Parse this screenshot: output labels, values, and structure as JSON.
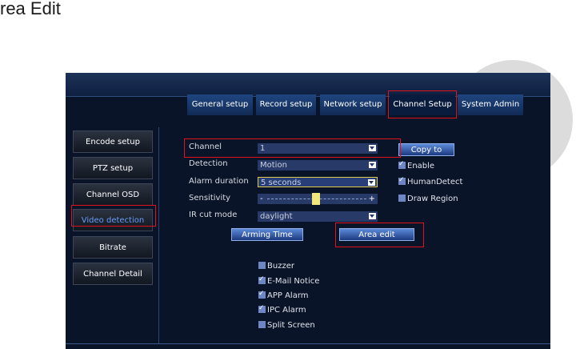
{
  "page_title": "rea Edit",
  "tabs": [
    {
      "label": "General setup"
    },
    {
      "label": "Record setup"
    },
    {
      "label": "Network setup"
    },
    {
      "label": "Channel Setup"
    },
    {
      "label": "System Admin"
    }
  ],
  "active_tab": "Channel Setup",
  "sidebar": {
    "items": [
      {
        "label": "Encode setup"
      },
      {
        "label": "PTZ setup"
      },
      {
        "label": "Channel OSD"
      },
      {
        "label": "Video detection"
      },
      {
        "label": "Bitrate"
      },
      {
        "label": "Channel Detail"
      }
    ],
    "active": "Video detection"
  },
  "form": {
    "channel": {
      "label": "Channel",
      "value": "1"
    },
    "detection": {
      "label": "Detection",
      "value": "Motion"
    },
    "alarm_duration": {
      "label": "Alarm duration",
      "value": "5 seconds"
    },
    "sensitivity": {
      "label": "Sensitivity",
      "level": 0.5
    },
    "ir_cut_mode": {
      "label": "IR cut mode",
      "value": "daylight"
    }
  },
  "buttons": {
    "copy_to": "Copy to",
    "arming_time": "Arming Time",
    "area_edit": "Area edit"
  },
  "right_options": [
    {
      "label": "Enable",
      "checked": true
    },
    {
      "label": "HumanDetect",
      "checked": true
    },
    {
      "label": "Draw Region",
      "checked": false
    }
  ],
  "alarm_options": [
    {
      "label": "Buzzer",
      "checked": false
    },
    {
      "label": "E-Mail Notice",
      "checked": true
    },
    {
      "label": "APP Alarm",
      "checked": true
    },
    {
      "label": "IPC Alarm",
      "checked": true
    },
    {
      "label": "Split Screen",
      "checked": false
    }
  ],
  "colors": {
    "screen_bg": "#0a1428",
    "tab_bg": "#1f4680",
    "highlight": "#e0121c",
    "field_bg": "#283a68"
  }
}
